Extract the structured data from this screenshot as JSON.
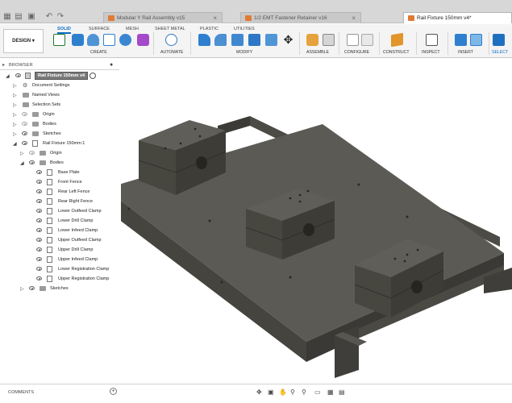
{
  "tabs": [
    {
      "label": "Modular Y Rail Assembly v15",
      "active": false
    },
    {
      "label": "1/2 EMT Fastener Retainer v16",
      "active": false
    },
    {
      "label": "Rail Fixture 150mm v4*",
      "active": true
    }
  ],
  "toolbar": {
    "workspace": "DESIGN",
    "tabs": [
      "SOLID",
      "SURFACE",
      "MESH",
      "SHEET METAL",
      "PLASTIC",
      "UTILITIES"
    ],
    "groups": [
      "CREATE",
      "AUTOMATE",
      "MODIFY",
      "ASSEMBLE",
      "CONFIGURE",
      "CONSTRUCT",
      "INSPECT",
      "INSERT",
      "SELECT"
    ]
  },
  "browser": {
    "title": "BROWSER",
    "root": "Rail Fixture 150mm v4",
    "items": [
      {
        "label": "Document Settings"
      },
      {
        "label": "Named Views"
      },
      {
        "label": "Selection Sets"
      },
      {
        "label": "Origin"
      },
      {
        "label": "Bodies"
      },
      {
        "label": "Sketches"
      }
    ],
    "component": "Rail Fixture 150mm:1",
    "component_items": [
      {
        "label": "Origin"
      },
      {
        "label": "Bodies"
      }
    ],
    "bodies": [
      "Base Plate",
      "Front Fence",
      "Rear Left Fence",
      "Rear Right Fence",
      "Lower Outfeed Clamp",
      "Lower Drill Clamp",
      "Lower Infeed Clamp",
      "Upper Outfeed Clamp",
      "Upper Drill Clamp",
      "Upper Infeed Clamp",
      "Lower Registration Clamp",
      "Upper Registration Clamp"
    ],
    "sketches": "Sketches"
  },
  "comments": {
    "label": "COMMENTS"
  },
  "colors": {
    "accent": "#0a6fc2",
    "model_top": "#5b5a55",
    "model_front": "#45443f",
    "model_side": "#3a3935"
  }
}
